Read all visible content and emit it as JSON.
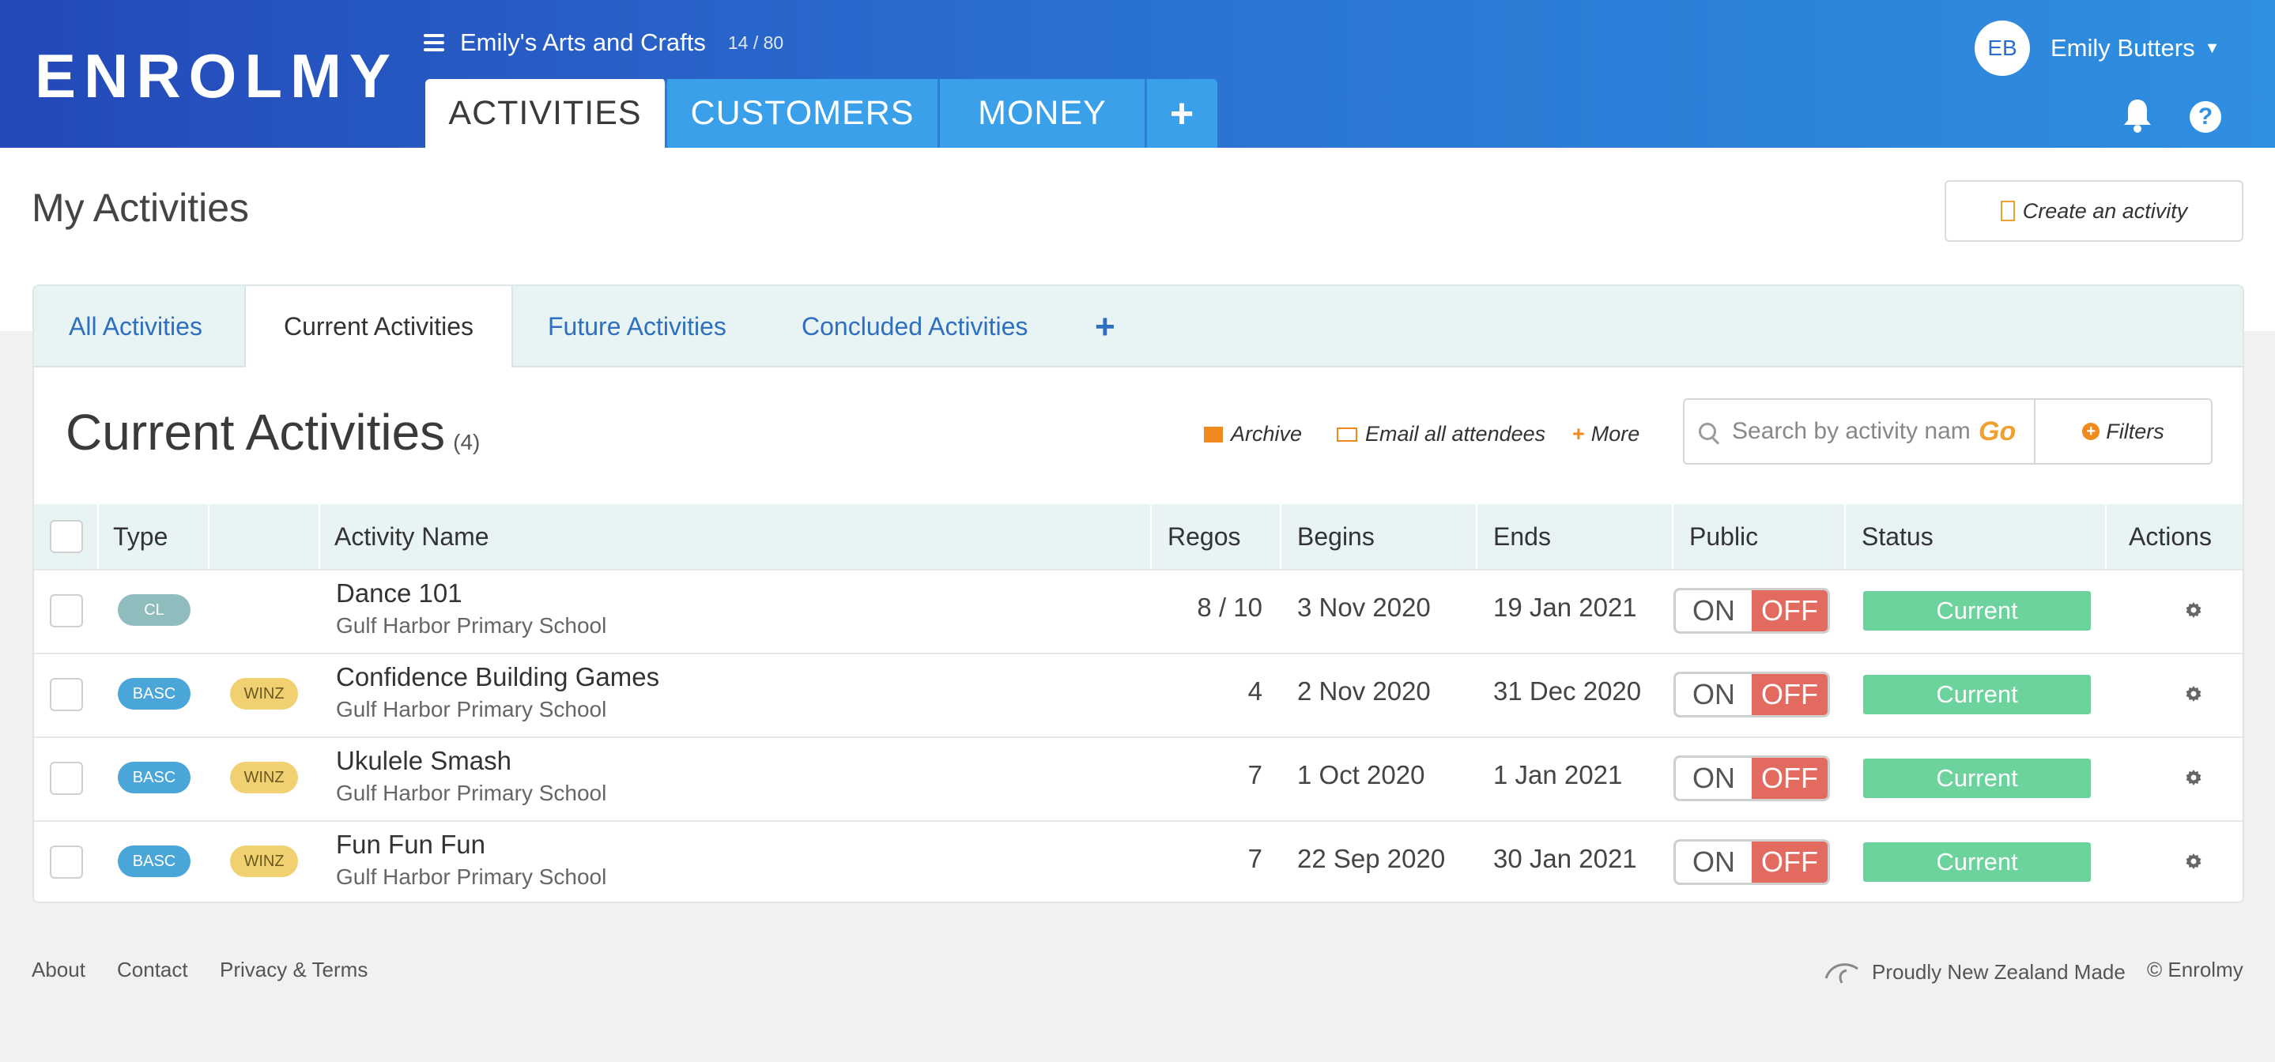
{
  "header": {
    "logo": "ENROLMY",
    "org_name": "Emily's Arts and Crafts",
    "org_count": "14 / 80",
    "nav_tabs": [
      "ACTIVITIES",
      "CUSTOMERS",
      "MONEY",
      "+"
    ],
    "user_initials": "EB",
    "user_name": "Emily Butters",
    "help_glyph": "?"
  },
  "page": {
    "title": "My Activities",
    "create_button": "Create an activity"
  },
  "subtabs": [
    "All Activities",
    "Current Activities",
    "Future Activities",
    "Concluded Activities",
    "+"
  ],
  "section": {
    "title": "Current Activities",
    "count": "(4)",
    "archive": "Archive",
    "email_all": "Email all attendees",
    "more": "More",
    "more_glyph": "+",
    "search_placeholder": "Search by activity name",
    "go": "Go",
    "filters": "Filters",
    "filters_glyph": "+"
  },
  "table": {
    "headers": [
      "Type",
      "",
      "Activity Name",
      "Regos",
      "Begins",
      "Ends",
      "Public",
      "Status",
      "Actions"
    ],
    "rows": [
      {
        "type": "CL",
        "tag": "",
        "name": "Dance 101",
        "venue": "Gulf Harbor Primary School",
        "regos": "8 / 10",
        "begins": "3 Nov 2020",
        "ends": "19 Jan 2021",
        "on": "ON",
        "off": "OFF",
        "status": "Current"
      },
      {
        "type": "BASC",
        "tag": "WINZ",
        "name": "Confidence Building Games",
        "venue": "Gulf Harbor Primary School",
        "regos": "4",
        "begins": "2 Nov 2020",
        "ends": "31 Dec 2020",
        "on": "ON",
        "off": "OFF",
        "status": "Current"
      },
      {
        "type": "BASC",
        "tag": "WINZ",
        "name": "Ukulele Smash",
        "venue": "Gulf Harbor Primary School",
        "regos": "7",
        "begins": "1 Oct 2020",
        "ends": "1 Jan 2021",
        "on": "ON",
        "off": "OFF",
        "status": "Current"
      },
      {
        "type": "BASC",
        "tag": "WINZ",
        "name": "Fun Fun Fun",
        "venue": "Gulf Harbor Primary School",
        "regos": "7",
        "begins": "22 Sep 2020",
        "ends": "30 Jan 2021",
        "on": "ON",
        "off": "OFF",
        "status": "Current"
      }
    ]
  },
  "footer": {
    "about": "About",
    "contact": "Contact",
    "privacy": "Privacy & Terms",
    "made": "Proudly New Zealand Made",
    "copyright": "© Enrolmy"
  },
  "colors": {
    "header_start": "#2448b8",
    "header_end": "#2f8fe0",
    "tab_blue": "#39a0e9",
    "accent_orange": "#f08a1c",
    "off_red": "#e36a5e",
    "status_green": "#6dd39d"
  }
}
